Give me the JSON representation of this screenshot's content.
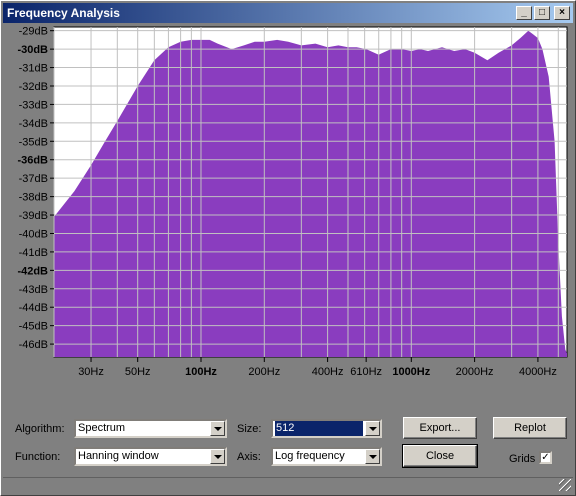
{
  "window": {
    "title": "Frequency Analysis",
    "minimize": "_",
    "maximize": "□",
    "close": "×"
  },
  "chart_data": {
    "type": "area",
    "title": "",
    "xlabel": "",
    "ylabel": "",
    "x_scale": "log",
    "xlim": [
      20,
      5500
    ],
    "ylim": [
      -46.7,
      -28.8
    ],
    "x_ticks": [
      {
        "value": 30,
        "label": "30Hz",
        "bold": false
      },
      {
        "value": 50,
        "label": "50Hz",
        "bold": false
      },
      {
        "value": 100,
        "label": "100Hz",
        "bold": true
      },
      {
        "value": 200,
        "label": "200Hz",
        "bold": false
      },
      {
        "value": 400,
        "label": "400Hz",
        "bold": false
      },
      {
        "value": 610,
        "label": "610Hz",
        "bold": false
      },
      {
        "value": 1000,
        "label": "1000Hz",
        "bold": true
      },
      {
        "value": 2000,
        "label": "2000Hz",
        "bold": false
      },
      {
        "value": 4000,
        "label": "4000Hz",
        "bold": false
      }
    ],
    "y_ticks": [
      {
        "value": -29,
        "label": "-29dB",
        "bold": false
      },
      {
        "value": -30,
        "label": "-30dB",
        "bold": true
      },
      {
        "value": -31,
        "label": "-31dB",
        "bold": false
      },
      {
        "value": -32,
        "label": "-32dB",
        "bold": false
      },
      {
        "value": -33,
        "label": "-33dB",
        "bold": false
      },
      {
        "value": -34,
        "label": "-34dB",
        "bold": false
      },
      {
        "value": -35,
        "label": "-35dB",
        "bold": false
      },
      {
        "value": -36,
        "label": "-36dB",
        "bold": true
      },
      {
        "value": -37,
        "label": "-37dB",
        "bold": false
      },
      {
        "value": -38,
        "label": "-38dB",
        "bold": false
      },
      {
        "value": -39,
        "label": "-39dB",
        "bold": false
      },
      {
        "value": -40,
        "label": "-40dB",
        "bold": false
      },
      {
        "value": -41,
        "label": "-41dB",
        "bold": false
      },
      {
        "value": -42,
        "label": "-42dB",
        "bold": true
      },
      {
        "value": -43,
        "label": "-43dB",
        "bold": false
      },
      {
        "value": -44,
        "label": "-44dB",
        "bold": false
      },
      {
        "value": -45,
        "label": "-45dB",
        "bold": false
      },
      {
        "value": -46,
        "label": "-46dB",
        "bold": false
      }
    ],
    "grid": true,
    "colors": {
      "fill": "#8a3dbf",
      "background": "#ffffff",
      "grid": "#c0c0c0"
    },
    "series": [
      {
        "x": [
          20,
          25,
          30,
          35,
          40,
          50,
          60,
          70,
          80,
          90,
          100,
          110,
          120,
          140,
          160,
          180,
          200,
          230,
          260,
          300,
          350,
          400,
          450,
          500,
          550,
          610,
          700,
          800,
          900,
          1000,
          1100,
          1200,
          1400,
          1600,
          1800,
          2000,
          2300,
          2600,
          3000,
          3300,
          3600,
          3800,
          4000,
          4200,
          4500,
          4800,
          5000,
          5200,
          5400,
          5500
        ],
        "y": [
          -39.1,
          -37.7,
          -36.3,
          -35.0,
          -33.9,
          -32.0,
          -30.6,
          -29.9,
          -29.6,
          -29.5,
          -29.5,
          -29.5,
          -29.7,
          -30.0,
          -29.8,
          -29.6,
          -29.6,
          -29.5,
          -29.6,
          -29.8,
          -29.7,
          -29.9,
          -29.8,
          -29.9,
          -29.9,
          -30.0,
          -30.3,
          -30.0,
          -30.0,
          -30.1,
          -30.0,
          -30.1,
          -29.9,
          -30.1,
          -30.0,
          -30.2,
          -30.6,
          -30.2,
          -29.8,
          -29.4,
          -29.0,
          -29.2,
          -29.4,
          -30.0,
          -31.5,
          -35.0,
          -40.5,
          -44.5,
          -46.3,
          -46.5
        ]
      }
    ]
  },
  "controls": {
    "algorithm_label": "Algorithm:",
    "algorithm_value": "Spectrum",
    "function_label": "Function:",
    "function_value": "Hanning window",
    "size_label": "Size:",
    "size_value": "512",
    "axis_label": "Axis:",
    "axis_value": "Log frequency",
    "export_button": "Export...",
    "replot_button": "Replot",
    "close_button": "Close",
    "grids_label": "Grids",
    "grids_checked": "✓"
  }
}
